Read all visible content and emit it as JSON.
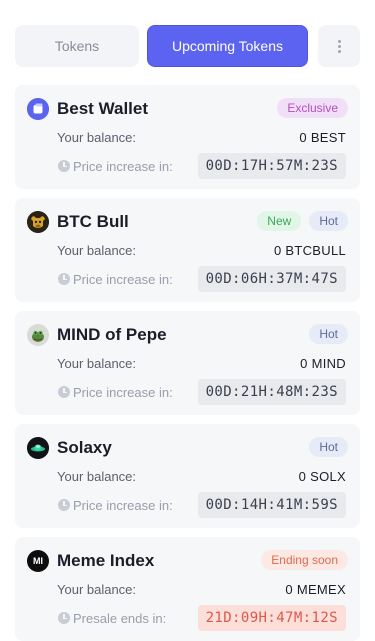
{
  "tabs": {
    "tokens_label": "Tokens",
    "upcoming_label": "Upcoming Tokens",
    "more_icon": "more-vertical-icon"
  },
  "colors": {
    "accent": "#5b63f0",
    "card_bg": "#f6f7f9",
    "ending_timer": "#e0584a"
  },
  "tokens": [
    {
      "name": "Best Wallet",
      "logo_icon": "best-wallet-logo",
      "badges": [
        "Exclusive"
      ],
      "balance_label": "Your balance:",
      "balance_value": "0 BEST",
      "timer_label": "Price increase in:",
      "timer_value": "00D:17H:57M:23S"
    },
    {
      "name": "BTC Bull",
      "logo_icon": "btc-bull-logo",
      "badges": [
        "New",
        "Hot"
      ],
      "balance_label": "Your balance:",
      "balance_value": "0 BTCBULL",
      "timer_label": "Price increase in:",
      "timer_value": "00D:06H:37M:47S"
    },
    {
      "name": "MIND of Pepe",
      "logo_icon": "mind-of-pepe-logo",
      "badges": [
        "Hot"
      ],
      "balance_label": "Your balance:",
      "balance_value": "0 MIND",
      "timer_label": "Price increase in:",
      "timer_value": "00D:21H:48M:23S"
    },
    {
      "name": "Solaxy",
      "logo_icon": "solaxy-logo",
      "badges": [
        "Hot"
      ],
      "balance_label": "Your balance:",
      "balance_value": "0 SOLX",
      "timer_label": "Price increase in:",
      "timer_value": "00D:14H:41M:59S"
    },
    {
      "name": "Meme Index",
      "logo_icon": "meme-index-logo",
      "logo_text": "MI",
      "badges": [
        "Ending soon"
      ],
      "balance_label": "Your balance:",
      "balance_value": "0 MEMEX",
      "timer_label": "Presale ends in:",
      "timer_value": "21D:09H:47M:12S"
    }
  ]
}
